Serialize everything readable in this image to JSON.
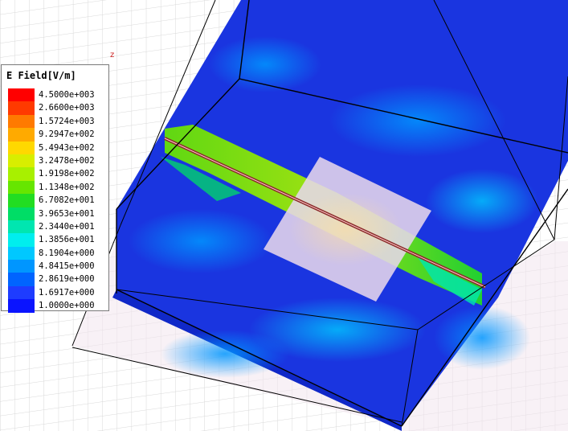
{
  "legend": {
    "title": "E Field[V/m]",
    "entries": [
      {
        "value": "4.5000e+003",
        "color": "#ff0000"
      },
      {
        "value": "2.6600e+003",
        "color": "#ff3a00"
      },
      {
        "value": "1.5724e+003",
        "color": "#ff7a00"
      },
      {
        "value": "9.2947e+002",
        "color": "#ffaa00"
      },
      {
        "value": "5.4943e+002",
        "color": "#ffd800"
      },
      {
        "value": "3.2478e+002",
        "color": "#d8ee00"
      },
      {
        "value": "1.9198e+002",
        "color": "#a8f000"
      },
      {
        "value": "1.1348e+002",
        "color": "#66e600"
      },
      {
        "value": "6.7082e+001",
        "color": "#22dd22"
      },
      {
        "value": "3.9653e+001",
        "color": "#00dd66"
      },
      {
        "value": "2.3440e+001",
        "color": "#00e6b0"
      },
      {
        "value": "1.3856e+001",
        "color": "#00eeee"
      },
      {
        "value": "8.1904e+000",
        "color": "#00c8ff"
      },
      {
        "value": "4.8415e+000",
        "color": "#0096ff"
      },
      {
        "value": "2.8619e+000",
        "color": "#0064ff"
      },
      {
        "value": "1.6917e+000",
        "color": "#1e3cff"
      },
      {
        "value": "1.0000e+000",
        "color": "#0a14ff"
      }
    ]
  },
  "axis_marker": "z",
  "colors": {
    "background": "#ffffff",
    "grid": "#d8d8d8",
    "box_face": "#f6ecf2",
    "field_base": "#1a35e0",
    "patch": "#e6d6ea",
    "microstrip": "#8a2a2a"
  }
}
